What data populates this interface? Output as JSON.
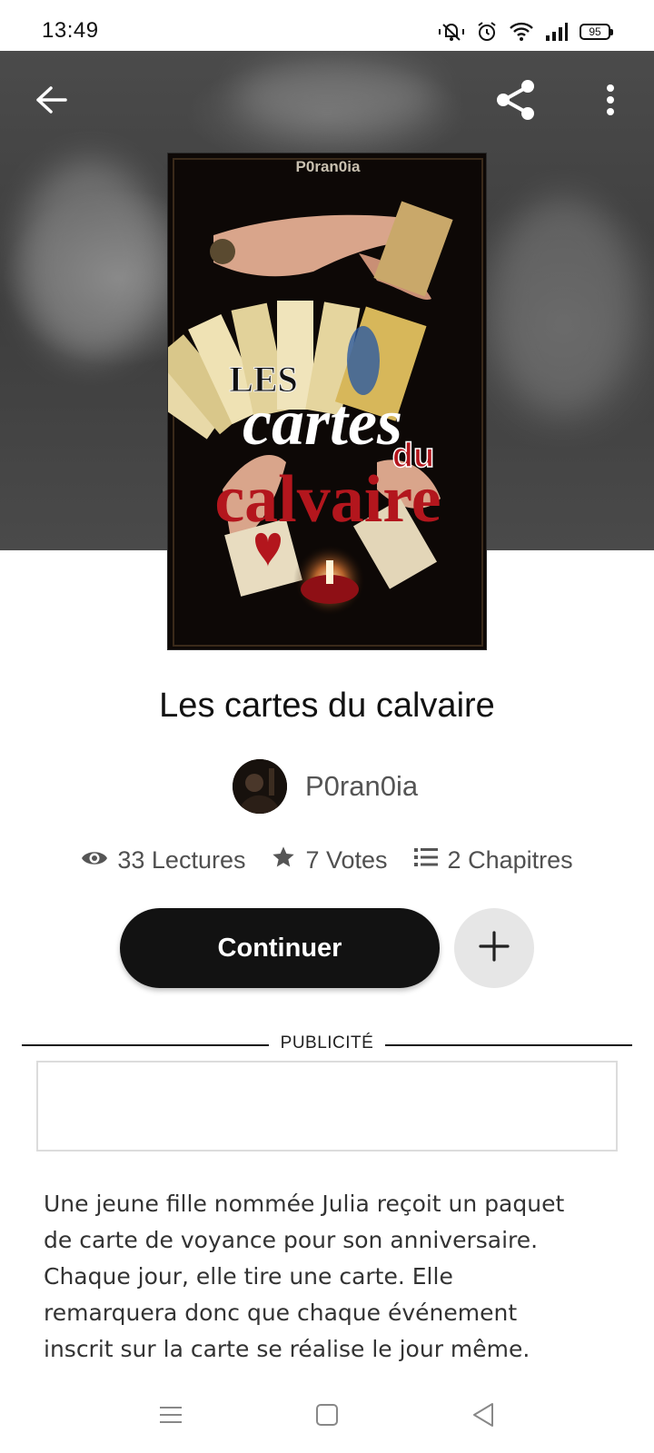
{
  "status_bar": {
    "time": "13:49",
    "battery": "95",
    "icons": [
      "mute-vibrate-icon",
      "alarm-icon",
      "wifi-icon",
      "signal-icon",
      "battery-icon"
    ]
  },
  "header": {
    "icons": [
      "back-arrow-icon",
      "share-icon",
      "more-vertical-icon"
    ]
  },
  "book": {
    "cover_author_text": "P0ran0ia",
    "cover_title_lines": [
      "LES",
      "cartes",
      "du",
      "calvaire"
    ],
    "title": "Les cartes du calvaire",
    "author": "P0ran0ia",
    "stats": {
      "reads": "33 Lectures",
      "votes": "7 Votes",
      "chapters": "2 Chapitres"
    },
    "continue_label": "Continuer",
    "description": "Une jeune fille nommée Julia reçoit un paquet de carte de voyance pour son anniversaire. Chaque jour, elle tire une carte. Elle remarquera donc que chaque événement inscrit sur la carte se réalise le jour même. Certaines cartes"
  },
  "ad": {
    "label": "PUBLICITÉ"
  },
  "colors": {
    "primary_button": "#121212",
    "secondary_button": "#e6e6e6",
    "cover_title_red": "#b3161d"
  }
}
